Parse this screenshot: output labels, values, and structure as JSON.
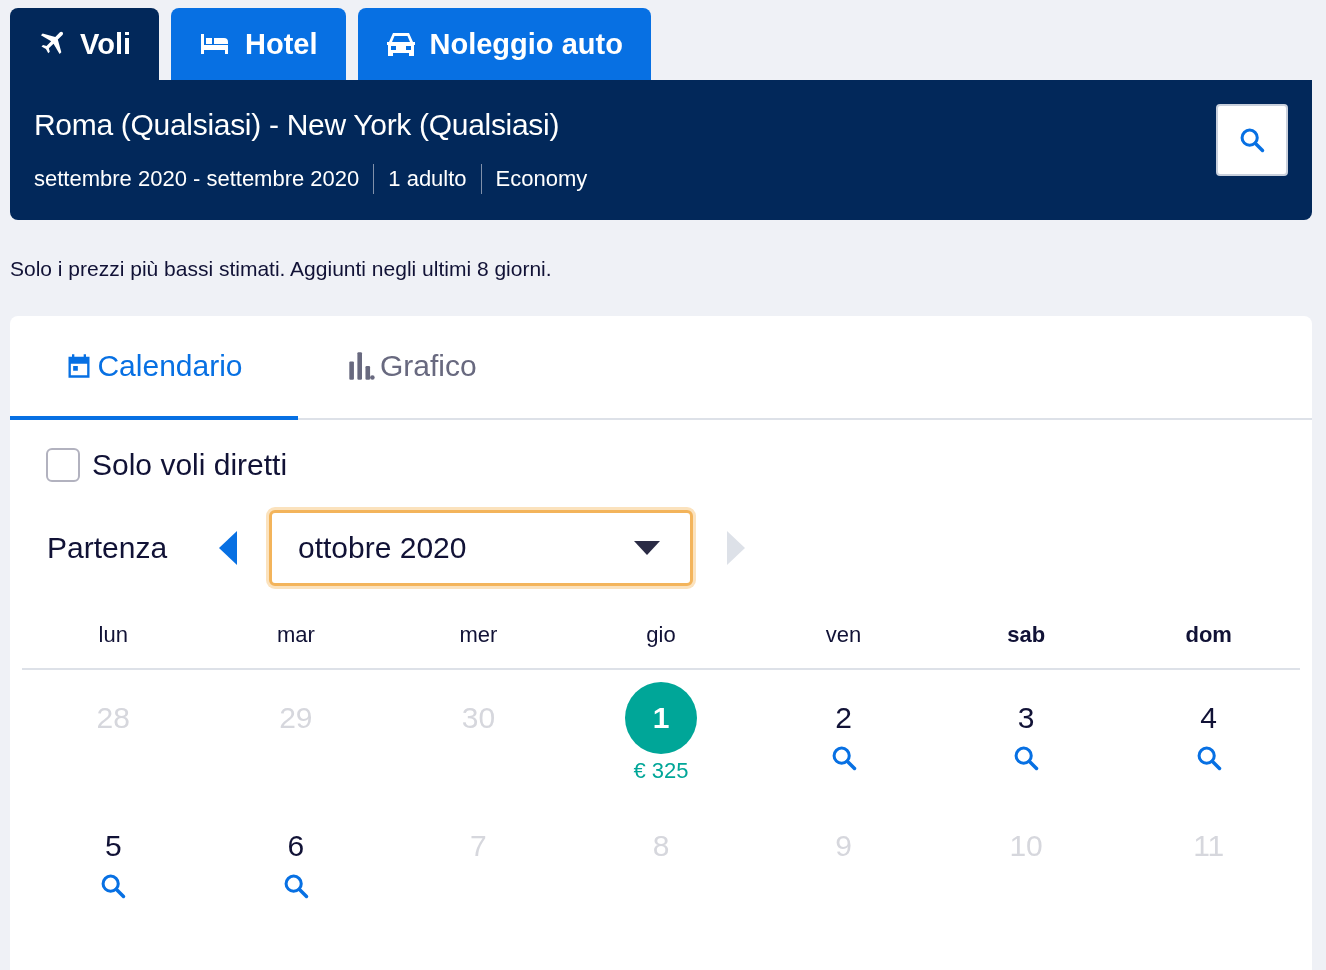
{
  "tabs": [
    {
      "label": "Voli",
      "kind": "plane",
      "selected": true
    },
    {
      "label": "Hotel",
      "kind": "bed",
      "selected": false
    },
    {
      "label": "Noleggio auto",
      "kind": "car",
      "selected": false
    }
  ],
  "search": {
    "title": "Roma (Qualsiasi) - New York (Qualsiasi)",
    "details": [
      "settembre 2020 - settembre 2020",
      "1 adulto",
      "Economy"
    ]
  },
  "note": "Solo i prezzi più bassi stimati. Aggiunti negli ultimi 8 giorni.",
  "view_tabs": [
    {
      "label": "Calendario",
      "kind": "calendar",
      "selected": true
    },
    {
      "label": "Grafico",
      "kind": "chart",
      "selected": false
    }
  ],
  "direct_only": {
    "label": "Solo voli diretti",
    "checked": false
  },
  "departure": {
    "label": "Partenza",
    "month": "ottobre 2020",
    "prev_disabled": false,
    "next_disabled": true
  },
  "weekdays": [
    {
      "label": "lun",
      "weekend": false
    },
    {
      "label": "mar",
      "weekend": false
    },
    {
      "label": "mer",
      "weekend": false
    },
    {
      "label": "gio",
      "weekend": false
    },
    {
      "label": "ven",
      "weekend": false
    },
    {
      "label": "sab",
      "weekend": true
    },
    {
      "label": "dom",
      "weekend": true
    }
  ],
  "days": [
    {
      "day": "28",
      "kind": "muted"
    },
    {
      "day": "29",
      "kind": "muted"
    },
    {
      "day": "30",
      "kind": "muted"
    },
    {
      "day": "1",
      "kind": "selected",
      "price": "€ 325"
    },
    {
      "day": "2",
      "kind": "search"
    },
    {
      "day": "3",
      "kind": "search"
    },
    {
      "day": "4",
      "kind": "search"
    },
    {
      "day": "5",
      "kind": "search"
    },
    {
      "day": "6",
      "kind": "search"
    },
    {
      "day": "7",
      "kind": "muted"
    },
    {
      "day": "8",
      "kind": "muted"
    },
    {
      "day": "9",
      "kind": "muted"
    },
    {
      "day": "10",
      "kind": "muted"
    },
    {
      "day": "11",
      "kind": "muted"
    }
  ]
}
